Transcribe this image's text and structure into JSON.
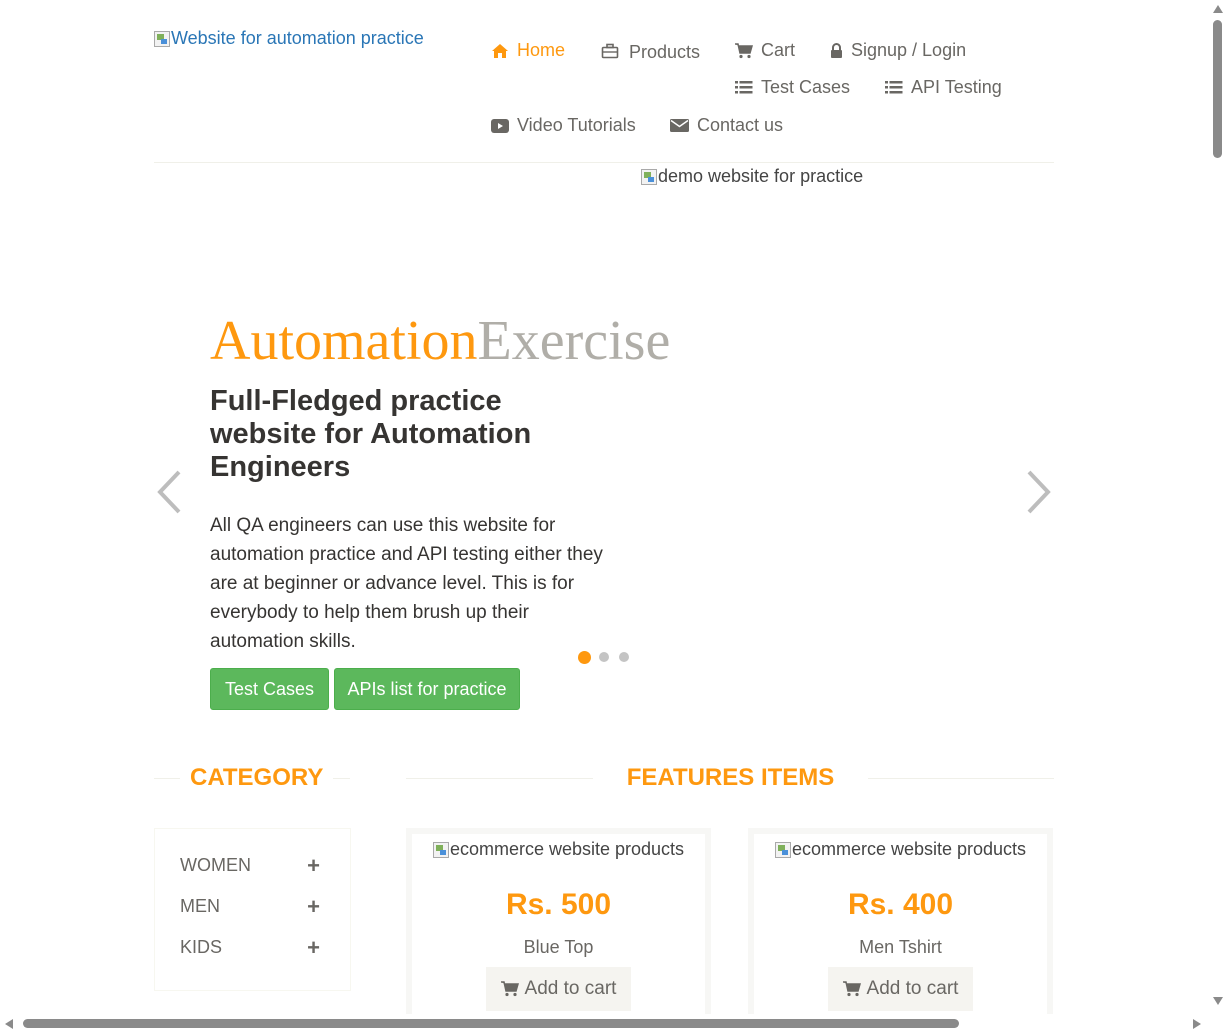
{
  "header": {
    "logo_alt": "Website for automation practice",
    "nav": [
      {
        "label": "Home",
        "icon": "home-icon",
        "active": true
      },
      {
        "label": "Products",
        "icon": "briefcase-icon"
      },
      {
        "label": "Cart",
        "icon": "shopping-cart-icon"
      },
      {
        "label": "Signup / Login",
        "icon": "lock-icon"
      },
      {
        "label": "Test Cases",
        "icon": "list-icon"
      },
      {
        "label": "API Testing",
        "icon": "list-icon"
      },
      {
        "label": "Video Tutorials",
        "icon": "youtube-play-icon"
      },
      {
        "label": "Contact us",
        "icon": "envelope-icon"
      }
    ]
  },
  "slider": {
    "image_alt": "demo website for practice",
    "brand_part1": "Automation",
    "brand_part2": "Exercise",
    "heading": "Full-Fledged practice website for Automation Engineers",
    "text": "All QA engineers can use this website for automation practice and API testing either they are at beginner or advance level. This is for everybody to help them brush up their automation skills.",
    "buttons": [
      "Test Cases",
      "APIs list for practice"
    ],
    "active_slide": 1,
    "slide_count": 3
  },
  "sidebar": {
    "title": "CATEGORY",
    "categories": [
      {
        "label": "WOMEN",
        "icon": "plus-icon"
      },
      {
        "label": "MEN",
        "icon": "plus-icon"
      },
      {
        "label": "KIDS",
        "icon": "plus-icon"
      }
    ]
  },
  "features": {
    "title": "FEATURES ITEMS",
    "products": [
      {
        "image_alt": "ecommerce website products",
        "price": "Rs. 500",
        "name": "Blue Top",
        "button": "Add to cart"
      },
      {
        "image_alt": "ecommerce website products",
        "price": "Rs. 400",
        "name": "Men Tshirt",
        "button": "Add to cart"
      }
    ]
  },
  "colors": {
    "accent": "#fe980f",
    "text": "#696763",
    "button_green": "#5cb85c",
    "brand_grey": "#b0aea8"
  }
}
